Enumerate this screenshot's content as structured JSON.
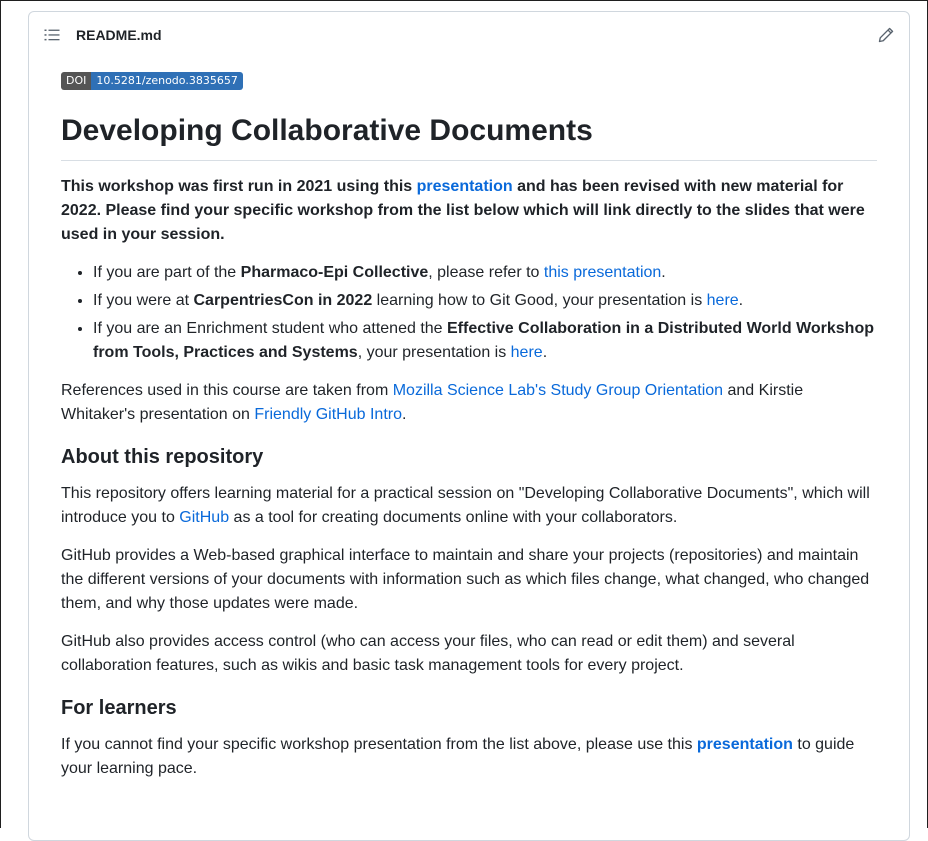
{
  "header": {
    "filename": "README.md",
    "list_icon": "list-unordered-icon",
    "edit_icon": "pencil-icon"
  },
  "badge": {
    "label": "DOI",
    "value": "10.5281/zenodo.3835657"
  },
  "title": "Developing Collaborative Documents",
  "intro": {
    "t1": "This workshop was first run in 2021 using this ",
    "link": "presentation",
    "t2": " and has been revised with new material for 2022. Please find your specific workshop from the list below which will link directly to the slides that were used in your session."
  },
  "bullets": [
    {
      "t1": "If you are part of the ",
      "b": "Pharmaco-Epi Collective",
      "t2": ", please refer to ",
      "link": "this presentation",
      "t3": "."
    },
    {
      "t1": "If you were at ",
      "b": "CarpentriesCon in 2022",
      "t2": " learning how to Git Good, your presentation is ",
      "link": "here",
      "t3": "."
    },
    {
      "t1": "If you are an Enrichment student who attened the ",
      "b": "Effective Collaboration in a Distributed World Workshop from Tools, Practices and Systems",
      "t2": ", your presentation is ",
      "link": "here",
      "t3": "."
    }
  ],
  "refs": {
    "t1": "References used in this course are taken from ",
    "link1": "Mozilla Science Lab's Study Group Orientation",
    "t2": " and Kirstie Whitaker's presentation on ",
    "link2": "Friendly GitHub Intro",
    "t3": "."
  },
  "about": {
    "heading": "About this repository",
    "p1a": "This repository offers learning material for a practical session on \"Developing Collaborative Documents\", which will introduce you to ",
    "p1link": "GitHub",
    "p1b": " as a tool for creating documents online with your collaborators.",
    "p2": "GitHub provides a Web-based graphical interface to maintain and share your projects (repositories) and maintain the different versions of your documents with information such as which files change, what changed, who changed them, and why those updates were made.",
    "p3": "GitHub also provides access control (who can access your files, who can read or edit them) and several collaboration features, such as wikis and basic task management tools for every project."
  },
  "learners": {
    "heading": "For learners",
    "t1": "If you cannot find your specific workshop presentation from the list above, please use this ",
    "link": "presentation",
    "t2": " to guide your learning pace."
  }
}
